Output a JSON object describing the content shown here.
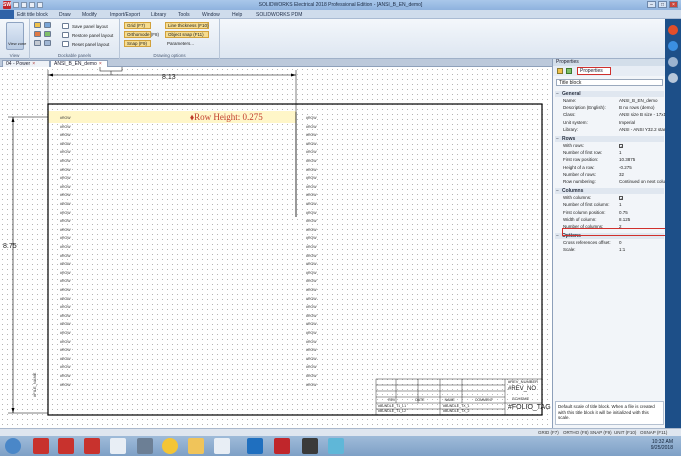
{
  "window": {
    "title": "SOLIDWORKS Electrical 2018 Professional Edition - [ANSI_B_EN_demo]",
    "app_icon": "SW"
  },
  "menubar": {
    "items": [
      "Edit title block",
      "Draw",
      "Modify",
      "Import/Export",
      "Library",
      "Tools",
      "Window",
      "Help",
      "SOLIDWORKS PDM"
    ]
  },
  "ribbon": {
    "view_button": "View zone",
    "panel_buttons": [
      "Save panel layout",
      "Restore panel layout",
      "Reset panel layout"
    ],
    "toggles_a": [
      "Grid (F7)",
      "Orthomode (F8)",
      "Snap (F9)"
    ],
    "toggles_b": [
      "Line thickness (F10)",
      "Object snap (F11)",
      "Parameters..."
    ],
    "panel_labels": [
      "View",
      "Dockable panels",
      "Drawing options"
    ]
  },
  "doc_tabs": [
    "04 - Power",
    "ANSI_B_EN_demo"
  ],
  "drawing": {
    "dimension_width": "8.13",
    "dimension_height": "8.75",
    "row_height_label": "Row Height: 0.275",
    "row_label": "#ROW",
    "rev_label": "#REV_NUMBER",
    "rev_tag": "#REV_NO",
    "scheme_tag": "SCHEME",
    "folio_tag": "#FOLIO_TAG",
    "file_name_vertical": "#FILE_NAME",
    "title_lines": [
      "#BUNDLE_T1_L1",
      "#BUNDLE_T1_L2",
      "#BUNDLE_TX_1",
      "#BUNDLE_TX_2"
    ],
    "table_headers": [
      "REV",
      "DATE",
      "NAME",
      "COMMENT"
    ]
  },
  "properties": {
    "title": "Properties",
    "tab_label": "Properties",
    "combo_value": "Title block",
    "sections": [
      {
        "name": "General",
        "rows": [
          {
            "name": "Name:",
            "value": "ANSI_B_EN_demo"
          },
          {
            "name": "Description (English):",
            "value": "B no rows (demo)"
          },
          {
            "name": "Class:",
            "value": "ANSI size B size - 17x11"
          },
          {
            "name": "Unit system:",
            "value": "Imperial"
          },
          {
            "name": "Library:",
            "value": "ANSI - ANSI Y32.2 standard"
          }
        ]
      },
      {
        "name": "Rows",
        "rows": [
          {
            "name": "With rows:",
            "value": "",
            "check": "✓"
          },
          {
            "name": "Number of first row:",
            "value": "1"
          },
          {
            "name": "First row position:",
            "value": "10.3875"
          },
          {
            "name": "Height of a row:",
            "value": "-0.275"
          },
          {
            "name": "Number of rows:",
            "value": "32"
          },
          {
            "name": "Row numbering:",
            "value": "Continued on next column"
          }
        ]
      },
      {
        "name": "Columns",
        "rows": [
          {
            "name": "With columns:",
            "value": "",
            "check": "✓"
          },
          {
            "name": "Number of first column:",
            "value": "1"
          },
          {
            "name": "First column position:",
            "value": "0.75"
          },
          {
            "name": "Width of column:",
            "value": "8.125"
          },
          {
            "name": "Number of columns:",
            "value": "2"
          }
        ]
      },
      {
        "name": "Options",
        "rows": [
          {
            "name": "Cross references offset:",
            "value": "0"
          },
          {
            "name": "Scale:",
            "value": "1:1"
          }
        ]
      }
    ],
    "description": "Default scale of title block. When a file is created with this title block it will be initialized with this scale."
  },
  "statusbar": {
    "items": [
      "GRID (F7)",
      "ORTHO (F8)",
      "SNAP (F9)",
      "UNIT (F10)",
      "OSNAP (F11)"
    ]
  },
  "taskbar": {
    "time": "10:32 AM",
    "date": "9/25/2018"
  },
  "colors": {
    "accent": "#2f62a7",
    "highlight_red": "#d0302d",
    "row_highlight": "#fff6c8"
  }
}
